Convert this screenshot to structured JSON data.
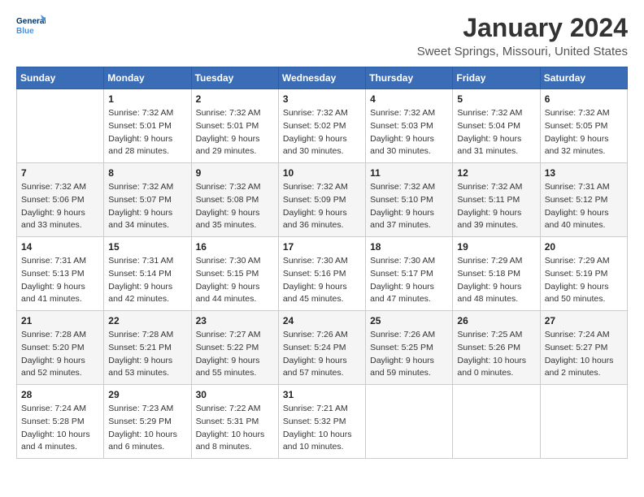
{
  "header": {
    "logo_line1": "General",
    "logo_line2": "Blue",
    "month": "January 2024",
    "location": "Sweet Springs, Missouri, United States"
  },
  "weekdays": [
    "Sunday",
    "Monday",
    "Tuesday",
    "Wednesday",
    "Thursday",
    "Friday",
    "Saturday"
  ],
  "weeks": [
    [
      {
        "day": "",
        "sunrise": "",
        "sunset": "",
        "daylight": ""
      },
      {
        "day": "1",
        "sunrise": "Sunrise: 7:32 AM",
        "sunset": "Sunset: 5:01 PM",
        "daylight": "Daylight: 9 hours and 28 minutes."
      },
      {
        "day": "2",
        "sunrise": "Sunrise: 7:32 AM",
        "sunset": "Sunset: 5:01 PM",
        "daylight": "Daylight: 9 hours and 29 minutes."
      },
      {
        "day": "3",
        "sunrise": "Sunrise: 7:32 AM",
        "sunset": "Sunset: 5:02 PM",
        "daylight": "Daylight: 9 hours and 30 minutes."
      },
      {
        "day": "4",
        "sunrise": "Sunrise: 7:32 AM",
        "sunset": "Sunset: 5:03 PM",
        "daylight": "Daylight: 9 hours and 30 minutes."
      },
      {
        "day": "5",
        "sunrise": "Sunrise: 7:32 AM",
        "sunset": "Sunset: 5:04 PM",
        "daylight": "Daylight: 9 hours and 31 minutes."
      },
      {
        "day": "6",
        "sunrise": "Sunrise: 7:32 AM",
        "sunset": "Sunset: 5:05 PM",
        "daylight": "Daylight: 9 hours and 32 minutes."
      }
    ],
    [
      {
        "day": "7",
        "sunrise": "Sunrise: 7:32 AM",
        "sunset": "Sunset: 5:06 PM",
        "daylight": "Daylight: 9 hours and 33 minutes."
      },
      {
        "day": "8",
        "sunrise": "Sunrise: 7:32 AM",
        "sunset": "Sunset: 5:07 PM",
        "daylight": "Daylight: 9 hours and 34 minutes."
      },
      {
        "day": "9",
        "sunrise": "Sunrise: 7:32 AM",
        "sunset": "Sunset: 5:08 PM",
        "daylight": "Daylight: 9 hours and 35 minutes."
      },
      {
        "day": "10",
        "sunrise": "Sunrise: 7:32 AM",
        "sunset": "Sunset: 5:09 PM",
        "daylight": "Daylight: 9 hours and 36 minutes."
      },
      {
        "day": "11",
        "sunrise": "Sunrise: 7:32 AM",
        "sunset": "Sunset: 5:10 PM",
        "daylight": "Daylight: 9 hours and 37 minutes."
      },
      {
        "day": "12",
        "sunrise": "Sunrise: 7:32 AM",
        "sunset": "Sunset: 5:11 PM",
        "daylight": "Daylight: 9 hours and 39 minutes."
      },
      {
        "day": "13",
        "sunrise": "Sunrise: 7:31 AM",
        "sunset": "Sunset: 5:12 PM",
        "daylight": "Daylight: 9 hours and 40 minutes."
      }
    ],
    [
      {
        "day": "14",
        "sunrise": "Sunrise: 7:31 AM",
        "sunset": "Sunset: 5:13 PM",
        "daylight": "Daylight: 9 hours and 41 minutes."
      },
      {
        "day": "15",
        "sunrise": "Sunrise: 7:31 AM",
        "sunset": "Sunset: 5:14 PM",
        "daylight": "Daylight: 9 hours and 42 minutes."
      },
      {
        "day": "16",
        "sunrise": "Sunrise: 7:30 AM",
        "sunset": "Sunset: 5:15 PM",
        "daylight": "Daylight: 9 hours and 44 minutes."
      },
      {
        "day": "17",
        "sunrise": "Sunrise: 7:30 AM",
        "sunset": "Sunset: 5:16 PM",
        "daylight": "Daylight: 9 hours and 45 minutes."
      },
      {
        "day": "18",
        "sunrise": "Sunrise: 7:30 AM",
        "sunset": "Sunset: 5:17 PM",
        "daylight": "Daylight: 9 hours and 47 minutes."
      },
      {
        "day": "19",
        "sunrise": "Sunrise: 7:29 AM",
        "sunset": "Sunset: 5:18 PM",
        "daylight": "Daylight: 9 hours and 48 minutes."
      },
      {
        "day": "20",
        "sunrise": "Sunrise: 7:29 AM",
        "sunset": "Sunset: 5:19 PM",
        "daylight": "Daylight: 9 hours and 50 minutes."
      }
    ],
    [
      {
        "day": "21",
        "sunrise": "Sunrise: 7:28 AM",
        "sunset": "Sunset: 5:20 PM",
        "daylight": "Daylight: 9 hours and 52 minutes."
      },
      {
        "day": "22",
        "sunrise": "Sunrise: 7:28 AM",
        "sunset": "Sunset: 5:21 PM",
        "daylight": "Daylight: 9 hours and 53 minutes."
      },
      {
        "day": "23",
        "sunrise": "Sunrise: 7:27 AM",
        "sunset": "Sunset: 5:22 PM",
        "daylight": "Daylight: 9 hours and 55 minutes."
      },
      {
        "day": "24",
        "sunrise": "Sunrise: 7:26 AM",
        "sunset": "Sunset: 5:24 PM",
        "daylight": "Daylight: 9 hours and 57 minutes."
      },
      {
        "day": "25",
        "sunrise": "Sunrise: 7:26 AM",
        "sunset": "Sunset: 5:25 PM",
        "daylight": "Daylight: 9 hours and 59 minutes."
      },
      {
        "day": "26",
        "sunrise": "Sunrise: 7:25 AM",
        "sunset": "Sunset: 5:26 PM",
        "daylight": "Daylight: 10 hours and 0 minutes."
      },
      {
        "day": "27",
        "sunrise": "Sunrise: 7:24 AM",
        "sunset": "Sunset: 5:27 PM",
        "daylight": "Daylight: 10 hours and 2 minutes."
      }
    ],
    [
      {
        "day": "28",
        "sunrise": "Sunrise: 7:24 AM",
        "sunset": "Sunset: 5:28 PM",
        "daylight": "Daylight: 10 hours and 4 minutes."
      },
      {
        "day": "29",
        "sunrise": "Sunrise: 7:23 AM",
        "sunset": "Sunset: 5:29 PM",
        "daylight": "Daylight: 10 hours and 6 minutes."
      },
      {
        "day": "30",
        "sunrise": "Sunrise: 7:22 AM",
        "sunset": "Sunset: 5:31 PM",
        "daylight": "Daylight: 10 hours and 8 minutes."
      },
      {
        "day": "31",
        "sunrise": "Sunrise: 7:21 AM",
        "sunset": "Sunset: 5:32 PM",
        "daylight": "Daylight: 10 hours and 10 minutes."
      },
      {
        "day": "",
        "sunrise": "",
        "sunset": "",
        "daylight": ""
      },
      {
        "day": "",
        "sunrise": "",
        "sunset": "",
        "daylight": ""
      },
      {
        "day": "",
        "sunrise": "",
        "sunset": "",
        "daylight": ""
      }
    ]
  ]
}
